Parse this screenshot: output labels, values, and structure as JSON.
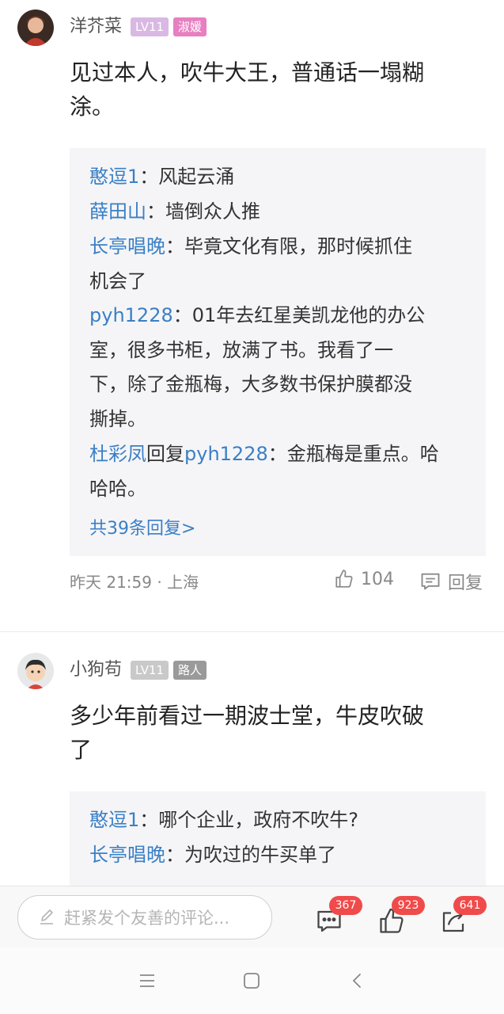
{
  "comments": [
    {
      "username": "洋芥菜",
      "level": "LV11",
      "title": "淑媛",
      "text_line1": "见过本人，吹牛大王，普通话一塌糊",
      "text_line2": "涂。",
      "replies": [
        {
          "lines": [
            {
              "name": "憨逗1",
              "sep": "：",
              "text": "风起云涌"
            }
          ]
        },
        {
          "lines": [
            {
              "name": "薛田山",
              "sep": "：",
              "text": "墙倒众人推"
            }
          ]
        },
        {
          "lines": [
            {
              "name": "长亭唱晚",
              "sep": "：",
              "text": "毕竟文化有限，那时候抓住"
            },
            {
              "text": "机会了"
            }
          ]
        },
        {
          "lines": [
            {
              "name": "pyh1228",
              "sep": "：",
              "text": "01年去红星美凯龙他的办公"
            },
            {
              "text": "室，很多书柜，放满了书。我看了一"
            },
            {
              "text": "下，除了金瓶梅，大多数书保护膜都没"
            },
            {
              "text": "撕掉。"
            }
          ]
        },
        {
          "lines": [
            {
              "name": "杜彩凤",
              "mid": "回复",
              "name2": "pyh1228",
              "sep": "：",
              "text": "金瓶梅是重点。哈"
            },
            {
              "text": "哈哈。"
            }
          ]
        }
      ],
      "more_replies": "共39条回复>",
      "meta": "昨天 21:59 · 上海",
      "likes": "104",
      "reply_label": "回复"
    },
    {
      "username": "小狗苟",
      "level": "LV11",
      "title": "路人",
      "text_line1": "多少年前看过一期波士堂，牛皮吹破",
      "text_line2": "了",
      "replies": [
        {
          "lines": [
            {
              "name": "憨逗1",
              "sep": "：",
              "text": "哪个企业，政府不吹牛?"
            }
          ]
        },
        {
          "lines": [
            {
              "name": "长亭唱晚",
              "sep": "：",
              "text": "为吹过的牛买单了"
            }
          ]
        }
      ]
    }
  ],
  "bottom_bar": {
    "placeholder": "赶紧发个友善的评论...",
    "comment_count": "367",
    "like_count": "923",
    "share_count": "641"
  },
  "colors": {
    "accent_blue": "#3a7fc6",
    "badge_level": "#d9b8e3",
    "badge_title": "#e77fc0",
    "badge_level_gray": "#c9c9c9",
    "badge_title_gray": "#9a9a9a",
    "notify_red": "#f04a4a"
  },
  "icons": [
    "pencil-icon",
    "comment-icon",
    "thumbs-up-icon",
    "share-icon",
    "menu-icon",
    "home-icon",
    "back-icon"
  ]
}
